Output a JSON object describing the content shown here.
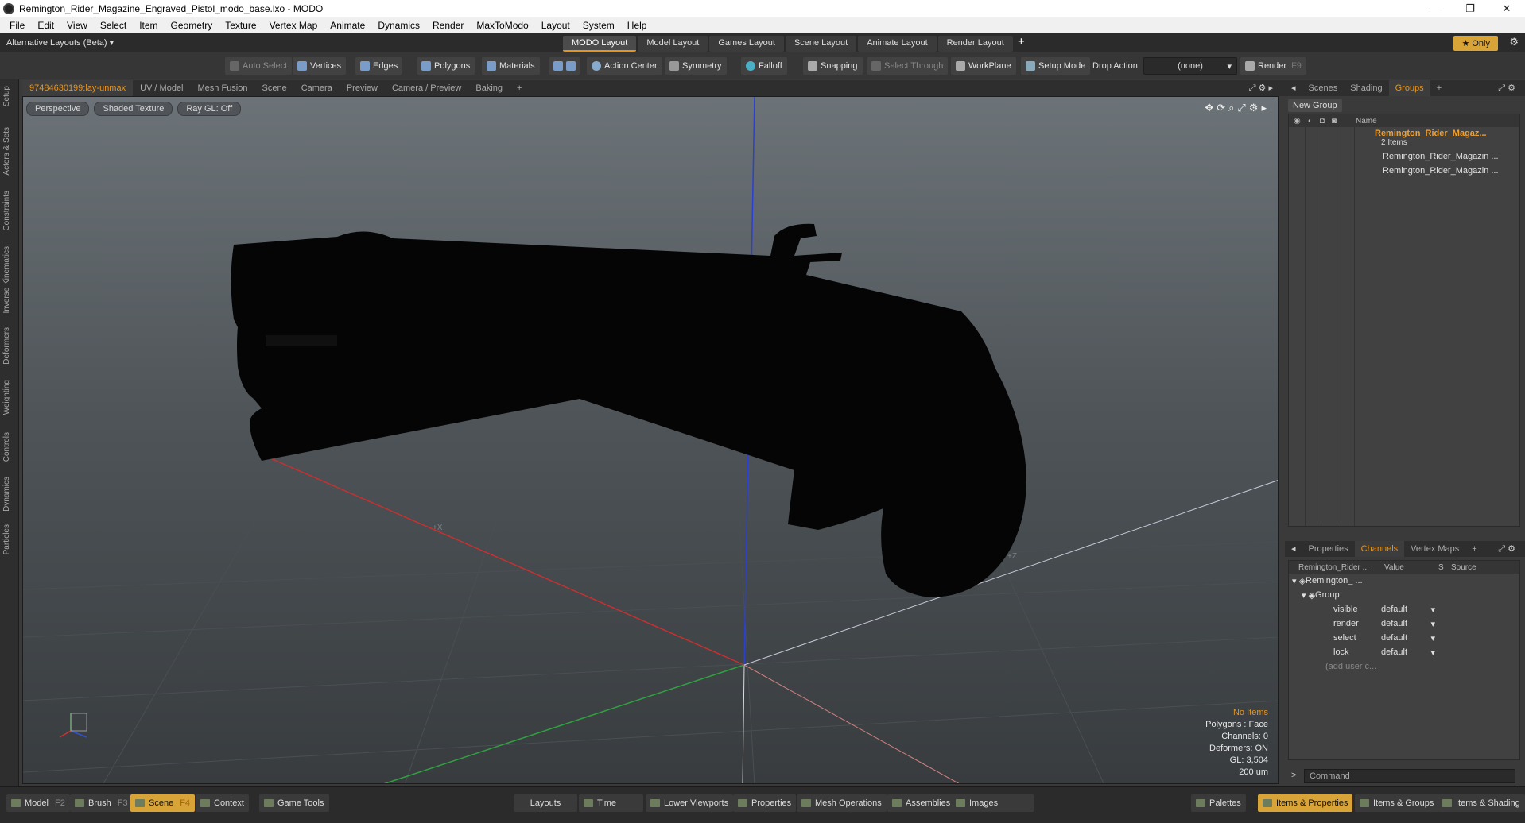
{
  "window": {
    "title": "Remington_Rider_Magazine_Engraved_Pistol_modo_base.lxo - MODO",
    "controls": [
      "—",
      "❐",
      "✕"
    ]
  },
  "menu": [
    "File",
    "Edit",
    "View",
    "Select",
    "Item",
    "Geometry",
    "Texture",
    "Vertex Map",
    "Animate",
    "Dynamics",
    "Render",
    "MaxToModo",
    "Layout",
    "System",
    "Help"
  ],
  "layoutbar": {
    "alt_layouts": "Alternative Layouts (Beta) ▾",
    "tabs": [
      "MODO Layout",
      "Model Layout",
      "Games Layout",
      "Scene Layout",
      "Animate Layout",
      "Render Layout"
    ],
    "active_tab": "MODO Layout",
    "only_label": "★ Only"
  },
  "toolbar": {
    "auto_select": "Auto Select",
    "vertices": "Vertices",
    "edges": "Edges",
    "polygons": "Polygons",
    "materials": "Materials",
    "action_center": "Action Center",
    "symmetry": "Symmetry",
    "falloff": "Falloff",
    "snapping": "Snapping",
    "select_through": "Select Through",
    "workplane": "WorkPlane",
    "setup_mode": "Setup Mode",
    "drop_action": "Drop Action",
    "drop_value": "(none)",
    "render": "Render",
    "render_key": "F9"
  },
  "left_tabs": [
    "Setup",
    "Actors & Sets",
    "Constraints",
    "Inverse Kinematics",
    "Deformers",
    "Weighting",
    "Controls",
    "Dynamics",
    "Particles"
  ],
  "viewport_tabs": [
    "97484630199:lay-unmax",
    "UV / Model",
    "Mesh Fusion",
    "Scene",
    "Camera",
    "Preview",
    "Camera / Preview",
    "Baking",
    "+"
  ],
  "viewport": {
    "view": "Perspective",
    "shading": "Shaded Texture",
    "raygl": "Ray GL: Off",
    "axis_x": "+X",
    "axis_z": "+Z",
    "stats": {
      "items": "No Items",
      "polygons": "Polygons : Face",
      "channels": "Channels: 0",
      "deformers": "Deformers: ON",
      "gl": "GL: 3,504",
      "unit": "200 um"
    }
  },
  "groups_panel": {
    "tabs": [
      "Scenes",
      "Shading",
      "Groups",
      "+"
    ],
    "active_tab": "Groups",
    "new_group": "New Group",
    "name_header": "Name",
    "group_name": "Remington_Rider_Magaz...",
    "group_count": "2 Items",
    "children": [
      "Remington_Rider_Magazin ...",
      "Remington_Rider_Magazin ..."
    ]
  },
  "channels_panel": {
    "tabs": [
      "Properties",
      "Channels",
      "Vertex Maps",
      "+"
    ],
    "active_tab": "Channels",
    "headers": [
      "Remington_Rider ...",
      "Value",
      "S",
      "Source"
    ],
    "item": "Remington_ ...",
    "group": "Group",
    "rows": [
      {
        "name": "visible",
        "value": "default"
      },
      {
        "name": "render",
        "value": "default"
      },
      {
        "name": "select",
        "value": "default"
      },
      {
        "name": "lock",
        "value": "default"
      }
    ],
    "add_user": "(add user c..."
  },
  "command": {
    "placeholder": "Command",
    "arrow": ">"
  },
  "bottombar": {
    "model": "Model",
    "model_key": "F2",
    "brush": "Brush",
    "brush_key": "F3",
    "scene": "Scene",
    "scene_key": "F4",
    "context": "Context",
    "game_tools": "Game Tools",
    "layouts": "Layouts",
    "time": "Time",
    "lower_viewports": "Lower Viewports",
    "properties": "Properties",
    "mesh_operations": "Mesh Operations",
    "assemblies": "Assemblies",
    "images": "Images",
    "palettes": "Palettes",
    "items_properties": "Items & Properties",
    "items_groups": "Items & Groups",
    "items_shading": "Items & Shading"
  },
  "colors": {
    "accent": "#e8941a",
    "active_button": "#d8a438",
    "viewport_top": "#6c7378",
    "viewport_bottom": "#383c3f"
  }
}
